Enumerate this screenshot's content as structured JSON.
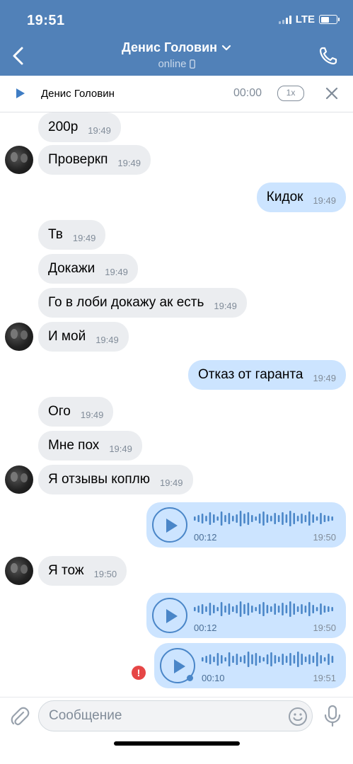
{
  "status_bar": {
    "time": "19:51",
    "network": "LTE",
    "icons": [
      "signal-icon",
      "battery-icon"
    ]
  },
  "header": {
    "title": "Денис Головин",
    "subtitle": "online",
    "icons": [
      "back-arrow-icon",
      "chevron-down-icon",
      "mobile-device-icon",
      "phone-icon"
    ],
    "accent_color": "#5181b8"
  },
  "player": {
    "name": "Денис Головин",
    "time": "00:00",
    "speed": "1x",
    "icons": [
      "play-icon",
      "close-icon"
    ]
  },
  "messages": [
    {
      "dir": "in",
      "text": "200р",
      "time": "19:49"
    },
    {
      "dir": "in",
      "text": "Проверкп",
      "time": "19:49",
      "avatar": true
    },
    {
      "dir": "out",
      "text": "Кидок",
      "time": "19:49"
    },
    {
      "dir": "in",
      "text": "Тв",
      "time": "19:49"
    },
    {
      "dir": "in",
      "text": "Докажи",
      "time": "19:49"
    },
    {
      "dir": "in",
      "text": "Го в лоби докажу ак есть",
      "time": "19:49"
    },
    {
      "dir": "in",
      "text": "И мой",
      "time": "19:49",
      "avatar": true
    },
    {
      "dir": "out",
      "text": "Отказ от гаранта",
      "time": "19:49"
    },
    {
      "dir": "in",
      "text": "Ого",
      "time": "19:49"
    },
    {
      "dir": "in",
      "text": "Мне пох",
      "time": "19:49"
    },
    {
      "dir": "in",
      "text": "Я отзывы коплю",
      "time": "19:49",
      "avatar": true
    },
    {
      "dir": "out",
      "type": "voice",
      "duration": "00:12",
      "time": "19:50"
    },
    {
      "dir": "in",
      "text": "Я тож",
      "time": "19:50",
      "avatar": true
    },
    {
      "dir": "out",
      "type": "voice",
      "duration": "00:12",
      "time": "19:50"
    },
    {
      "dir": "out",
      "type": "voice",
      "duration": "00:10",
      "time": "19:51",
      "failed": true
    }
  ],
  "composer": {
    "placeholder": "Сообщение",
    "icons": [
      "paperclip-icon",
      "emoji-icon",
      "microphone-icon"
    ]
  },
  "colors": {
    "incoming_bubble": "#ebedf0",
    "outgoing_bubble": "#cce4ff",
    "error": "#e64646"
  }
}
